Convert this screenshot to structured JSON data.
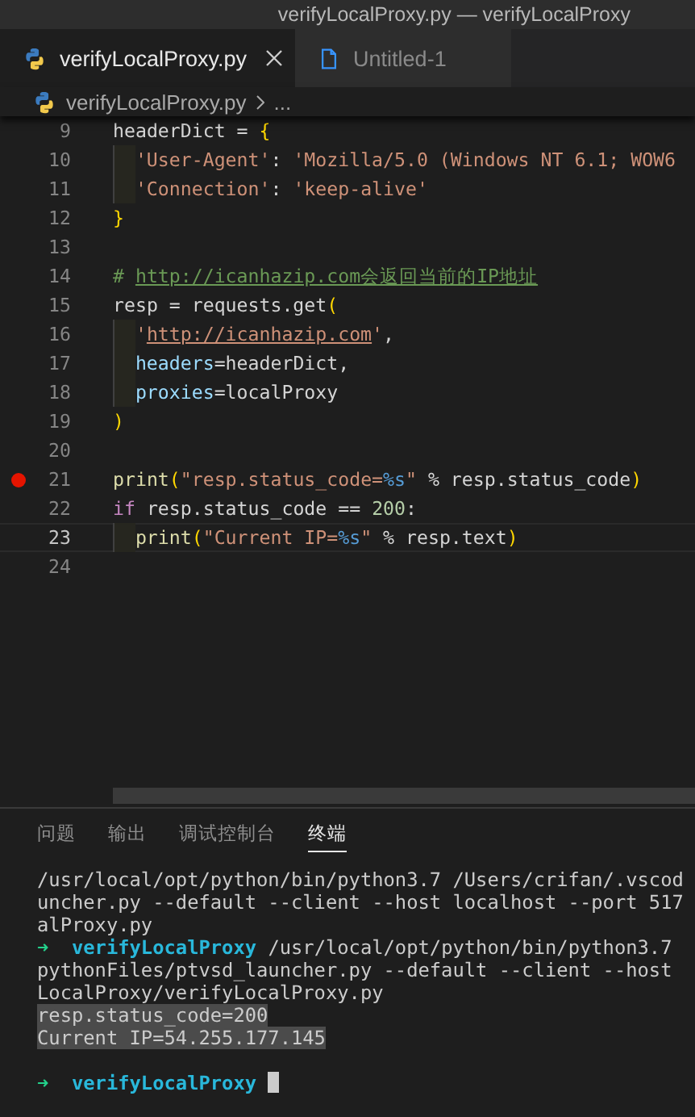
{
  "window": {
    "title": "verifyLocalProxy.py — verifyLocalProxy"
  },
  "tabs": [
    {
      "label": "verifyLocalProxy.py",
      "kind": "python",
      "selected": true
    },
    {
      "label": "Untitled-1",
      "kind": "file",
      "selected": false
    }
  ],
  "breadcrumb": {
    "file": "verifyLocalProxy.py",
    "more": "..."
  },
  "editor": {
    "lines": [
      {
        "number": "9",
        "tokens": [
          {
            "kind": "plain",
            "text": "headerDict = "
          },
          {
            "kind": "brace",
            "text": "{"
          }
        ]
      },
      {
        "number": "10",
        "indented": true,
        "tokens": [
          {
            "kind": "string",
            "text": "'User-Agent'"
          },
          {
            "kind": "plain",
            "text": ": "
          },
          {
            "kind": "string",
            "text": "'Mozilla/5.0 (Windows NT 6.1; WOW6"
          }
        ]
      },
      {
        "number": "11",
        "indented": true,
        "tokens": [
          {
            "kind": "string",
            "text": "'Connection'"
          },
          {
            "kind": "plain",
            "text": ": "
          },
          {
            "kind": "string",
            "text": "'keep-alive'"
          }
        ]
      },
      {
        "number": "12",
        "tokens": [
          {
            "kind": "brace",
            "text": "}"
          }
        ]
      },
      {
        "number": "13"
      },
      {
        "number": "14",
        "tokens": [
          {
            "kind": "comment",
            "text": "# "
          },
          {
            "kind": "comment-link",
            "text": "http://icanhazip.com会返回当前的IP地址"
          }
        ]
      },
      {
        "number": "15",
        "tokens": [
          {
            "kind": "plain",
            "text": "resp = requests.get"
          },
          {
            "kind": "brace",
            "text": "("
          }
        ]
      },
      {
        "number": "16",
        "indented": true,
        "tokens": [
          {
            "kind": "string",
            "text": "'"
          },
          {
            "kind": "string-link",
            "text": "http://icanhazip.com"
          },
          {
            "kind": "string",
            "text": "'"
          },
          {
            "kind": "plain",
            "text": ","
          }
        ]
      },
      {
        "number": "17",
        "indented": true,
        "tokens": [
          {
            "kind": "param",
            "text": "headers"
          },
          {
            "kind": "plain",
            "text": "=headerDict,"
          }
        ]
      },
      {
        "number": "18",
        "indented": true,
        "tokens": [
          {
            "kind": "param",
            "text": "proxies"
          },
          {
            "kind": "plain",
            "text": "=localProxy"
          }
        ]
      },
      {
        "number": "19",
        "tokens": [
          {
            "kind": "brace",
            "text": ")"
          }
        ]
      },
      {
        "number": "20"
      },
      {
        "number": "21",
        "breakpoint": true,
        "tokens": [
          {
            "kind": "func",
            "text": "print"
          },
          {
            "kind": "brace",
            "text": "("
          },
          {
            "kind": "string",
            "text": "\"resp.status_code="
          },
          {
            "kind": "format",
            "text": "%s"
          },
          {
            "kind": "string",
            "text": "\""
          },
          {
            "kind": "plain",
            "text": " % resp.status_code"
          },
          {
            "kind": "brace",
            "text": ")"
          }
        ]
      },
      {
        "number": "22",
        "tokens": [
          {
            "kind": "keyword",
            "text": "if"
          },
          {
            "kind": "plain",
            "text": " resp.status_code == "
          },
          {
            "kind": "number",
            "text": "200"
          },
          {
            "kind": "plain",
            "text": ":"
          }
        ]
      },
      {
        "number": "23",
        "current": true,
        "indented": true,
        "tokens": [
          {
            "kind": "func",
            "text": "print"
          },
          {
            "kind": "brace",
            "text": "("
          },
          {
            "kind": "string",
            "text": "\"Current IP="
          },
          {
            "kind": "format",
            "text": "%s"
          },
          {
            "kind": "string",
            "text": "\""
          },
          {
            "kind": "plain",
            "text": " % resp.text"
          },
          {
            "kind": "brace",
            "text": ")"
          }
        ]
      },
      {
        "number": "24"
      }
    ]
  },
  "panel": {
    "tabs": [
      {
        "label": "问题",
        "selected": false
      },
      {
        "label": "输出",
        "selected": false
      },
      {
        "label": "调试控制台",
        "selected": false
      },
      {
        "label": "终端",
        "selected": true
      }
    ],
    "terminal": [
      {
        "segments": [
          {
            "kind": "plain",
            "text": "/usr/local/opt/python/bin/python3.7 /Users/crifan/.vscod"
          }
        ]
      },
      {
        "segments": [
          {
            "kind": "plain",
            "text": "uncher.py --default --client --host localhost --port 517"
          }
        ]
      },
      {
        "segments": [
          {
            "kind": "plain",
            "text": "alProxy.py"
          }
        ]
      },
      {
        "segments": [
          {
            "kind": "arrow",
            "text": "➜"
          },
          {
            "kind": "dir",
            "text": "verifyLocalProxy"
          },
          {
            "kind": "plain",
            "text": "/usr/local/opt/python/bin/python3.7"
          }
        ]
      },
      {
        "segments": [
          {
            "kind": "plain",
            "text": "pythonFiles/ptvsd_launcher.py --default --client --host"
          }
        ]
      },
      {
        "segments": [
          {
            "kind": "plain",
            "text": "LocalProxy/verifyLocalProxy.py"
          }
        ]
      },
      {
        "selected": true,
        "segments": [
          {
            "kind": "plain",
            "text": "resp.status_code=200"
          }
        ]
      },
      {
        "selected": true,
        "segments": [
          {
            "kind": "plain",
            "text": "Current IP=54.255.177.145"
          }
        ]
      },
      {
        "gap_before": true,
        "cursor": true,
        "segments": [
          {
            "kind": "arrow",
            "text": "➜"
          },
          {
            "kind": "dir",
            "text": "verifyLocalProxy"
          }
        ]
      }
    ]
  }
}
